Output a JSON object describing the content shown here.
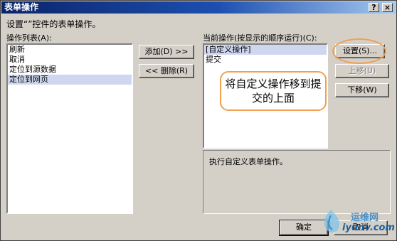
{
  "title": "表单操作",
  "title_buttons": {
    "help": "?",
    "close": "×"
  },
  "subtitle": "设置“”控件的表单操作。",
  "left_list": {
    "label": "操作列表(A):",
    "items": [
      "刷新",
      "取消",
      "定位到源数据",
      "定位到网页"
    ],
    "selected_index": 3
  },
  "add_button": "添加(D) >>",
  "remove_button": "<< 删除(R)",
  "right_list": {
    "label": "当前操作(按显示的顺序运行)(C):",
    "items": [
      "[自定义操作]",
      "提交"
    ],
    "selected_index": 0
  },
  "settings_button": "设置(S)...",
  "move_up_button": "上移(U)",
  "move_down_button": "下移(W)",
  "description": "执行自定义表单操作。",
  "ok_button": "确定",
  "cancel_button": "取消",
  "callout_text": "将自定义操作移到提交的上面",
  "watermark": {
    "cn": "运维网",
    "en": "iyunv.com"
  },
  "colors": {
    "highlight": "#f0a050",
    "selection": "#cfd7f0",
    "title_start": "#0a246a"
  }
}
